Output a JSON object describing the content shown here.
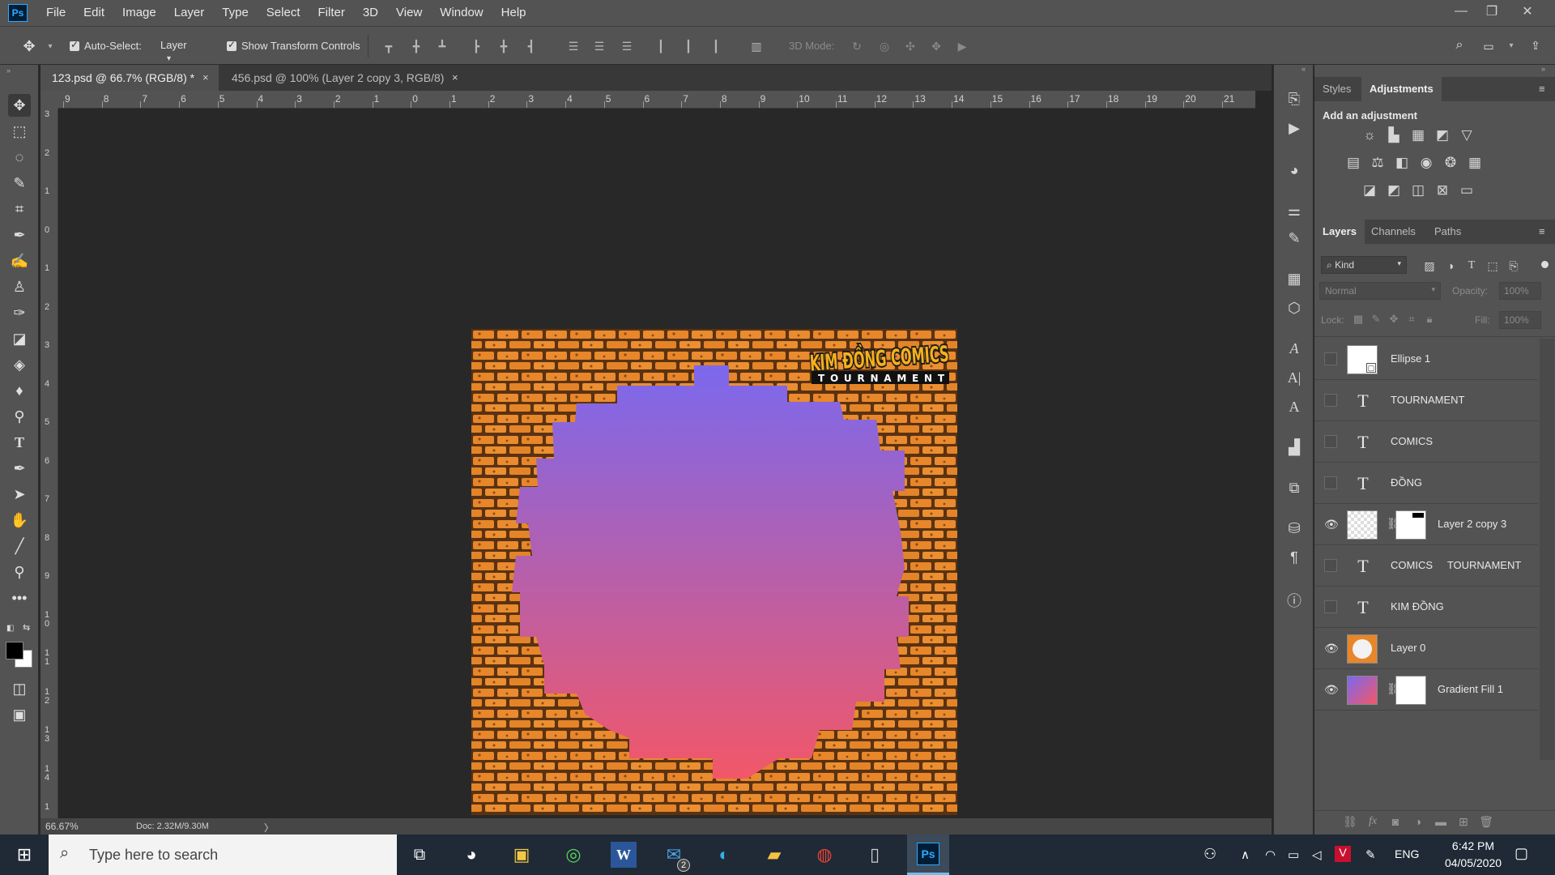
{
  "app": {
    "logo": "Ps"
  },
  "menu": [
    "File",
    "Edit",
    "Image",
    "Layer",
    "Type",
    "Select",
    "Filter",
    "3D",
    "View",
    "Window",
    "Help"
  ],
  "window_controls": {
    "minimize": "—",
    "restore": "❐",
    "close": "✕"
  },
  "options": {
    "auto_select_label": "Auto-Select:",
    "auto_select_value": "Layer",
    "show_transform_label": "Show Transform Controls",
    "three_d_mode_label": "3D Mode:"
  },
  "tabs": [
    {
      "label": "123.psd @ 66.7% (RGB/8) *",
      "close": "×"
    },
    {
      "label": "456.psd @ 100% (Layer 2 copy 3, RGB/8)",
      "close": "×"
    }
  ],
  "ruler_top": [
    "9",
    "8",
    "7",
    "6",
    "5",
    "4",
    "3",
    "2",
    "1",
    "0",
    "1",
    "2",
    "3",
    "4",
    "5",
    "6",
    "7",
    "8",
    "9",
    "10",
    "11",
    "12",
    "13",
    "14",
    "15",
    "16",
    "17",
    "18",
    "19",
    "20",
    "21"
  ],
  "ruler_left": [
    "3",
    "2",
    "1",
    "0",
    "1",
    "2",
    "3",
    "4",
    "5",
    "6",
    "7",
    "8",
    "9",
    "1 0",
    "1 1",
    "1 2",
    "1 3",
    "1 4",
    "1"
  ],
  "artwork": {
    "logo_line1": "KIM ĐỒNG COMICS",
    "logo_line2": "TOURNAMENT",
    "gradient_top": "#7b68ee",
    "gradient_bottom": "#f25768",
    "brick_color": "#e8862a"
  },
  "status": {
    "zoom": "66.67%",
    "doc": "Doc: 2.32M/9.30M",
    "arrow": "〉"
  },
  "adjustments_panel": {
    "tabs": [
      "Styles",
      "Adjustments"
    ],
    "heading": "Add an adjustment"
  },
  "layers_panel": {
    "tabs": [
      "Layers",
      "Channels",
      "Paths"
    ],
    "filter_kind": "Kind",
    "blend_mode": "Normal",
    "opacity_label": "Opacity:",
    "opacity_value": "100%",
    "lock_label": "Lock:",
    "fill_label": "Fill:",
    "fill_value": "100%",
    "layers": [
      {
        "name": "Ellipse 1",
        "type": "shape",
        "visible": false
      },
      {
        "name": "TOURNAMENT",
        "type": "text",
        "visible": false
      },
      {
        "name": "COMICS",
        "type": "text",
        "visible": false
      },
      {
        "name": "ĐỒNG",
        "type": "text",
        "visible": false
      },
      {
        "name": "Layer 2 copy 3",
        "type": "masked",
        "visible": true
      },
      {
        "name": "COMICS     TOURNAMENT",
        "type": "text",
        "visible": false
      },
      {
        "name": "KIM ĐỒNG",
        "type": "text",
        "visible": false
      },
      {
        "name": "Layer 0",
        "type": "image",
        "visible": true
      },
      {
        "name": "Gradient Fill 1",
        "type": "gradient",
        "visible": true
      }
    ]
  },
  "taskbar": {
    "search_placeholder": "Type here to search",
    "mail_badge": "2",
    "lang": "ENG",
    "time": "6:42 PM",
    "date": "04/05/2020"
  }
}
